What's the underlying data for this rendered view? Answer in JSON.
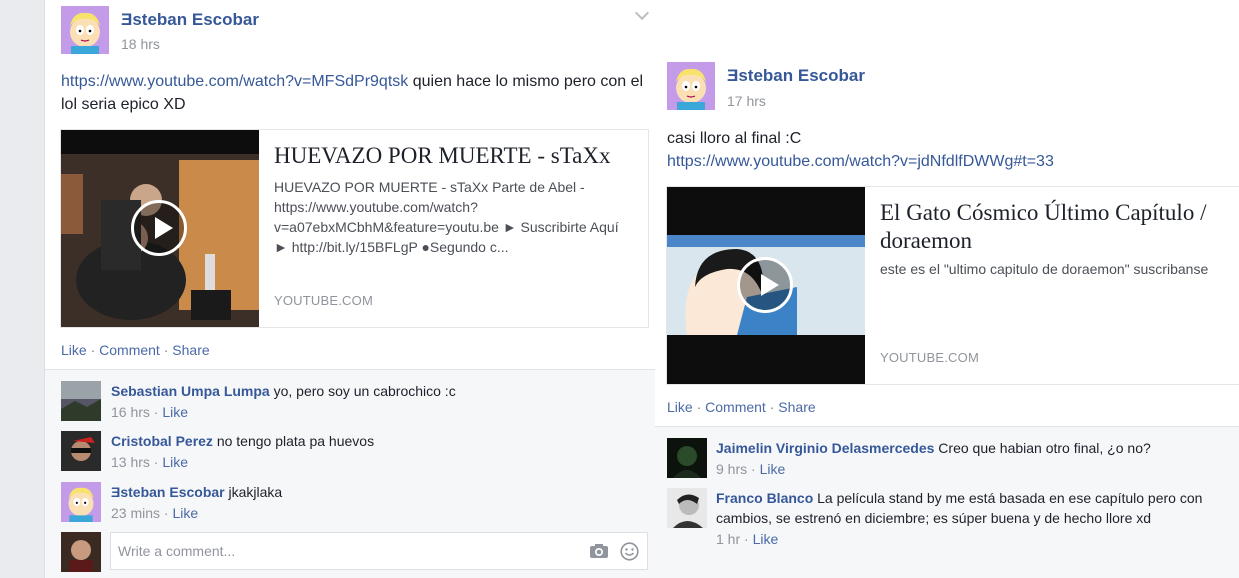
{
  "post1": {
    "author": "Ǝsteban Escobar",
    "time": "18 hrs",
    "text_link": "https://www.youtube.com/watch?v=MFSdPr9qtsk",
    "text_rest": " quien hace lo mismo pero con el lol seria epico XD",
    "card": {
      "title": "HUEVAZO POR MUERTE - sTaXx",
      "description": "HUEVAZO POR MUERTE - sTaXx Parte de Abel - https://www.youtube.com/watch?v=a07ebxMCbhM&feature=youtu.be ► Suscribirte Aquí ► http://bit.ly/15BFLgP ●Segundo c...",
      "source": "YOUTUBE.COM"
    },
    "actions": {
      "like": "Like",
      "comment": "Comment",
      "share": "Share",
      "sep": "·"
    },
    "comments": [
      {
        "name": "Sebastian Umpa Lumpa",
        "text": "yo, pero soy un cabrochico :c",
        "time": "16 hrs",
        "like": "Like"
      },
      {
        "name": "Cristobal Perez",
        "text": "no tengo plata pa huevos",
        "time": "13 hrs",
        "like": "Like"
      },
      {
        "name": "Ǝsteban Escobar",
        "text": "jkakjlaka",
        "time": "23 mins",
        "like": "Like"
      }
    ],
    "write_placeholder": "Write a comment..."
  },
  "post2": {
    "author": "Ǝsteban Escobar",
    "time": "17 hrs",
    "text_line1": "casi lloro al final :C",
    "text_link": "https://www.youtube.com/watch?v=jdNfdlfDWWg#t=33",
    "card": {
      "title": "El Gato Cósmico Último Capítulo / doraemon",
      "description": "este es el \"ultimo capitulo de doraemon\" suscribanse",
      "source": "YOUTUBE.COM"
    },
    "actions": {
      "like": "Like",
      "comment": "Comment",
      "share": "Share",
      "sep": "·"
    },
    "comments": [
      {
        "name": "Jaimelin Virginio Delasmercedes",
        "text": "Creo que habian otro final, ¿o no?",
        "time": "9 hrs",
        "like": "Like"
      },
      {
        "name": "Franco Blanco",
        "text": "La película stand by me está basada en ese capítulo pero con cambios, se estrenó en diciembre; es súper buena y de hecho llore xd",
        "time": "1 hr",
        "like": "Like"
      }
    ]
  },
  "colors": {
    "link": "#365899",
    "meta": "#90949c",
    "background": "#e9ebee"
  }
}
